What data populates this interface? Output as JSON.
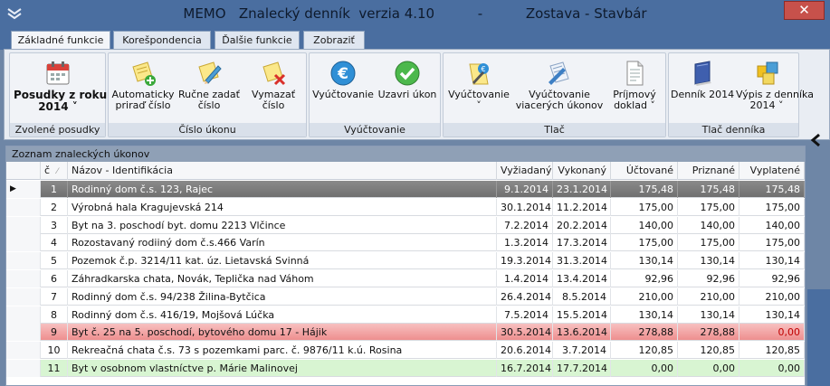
{
  "window": {
    "title": "MEMO   Znalecký denník  verzia 4.10          -          Zostava - Stavbár",
    "close_glyph": "✕"
  },
  "tabs": [
    {
      "label": "Základné funkcie",
      "active": true
    },
    {
      "label": "Korešpondencia",
      "active": false
    },
    {
      "label": "Ďalšie funkcie",
      "active": false
    },
    {
      "label": "Zobraziť",
      "active": false
    }
  ],
  "ribbon": {
    "groups": [
      {
        "label": "Zvolené posudky"
      },
      {
        "label": "Číslo úkonu"
      },
      {
        "label": "Vyúčtovanie"
      },
      {
        "label": "Tlač"
      },
      {
        "label": "Tlač denníka"
      }
    ],
    "buttons": {
      "posudky": {
        "line1": "Posudky z roku",
        "line2": "2014 ˅"
      },
      "auto": {
        "line1": "Automaticky",
        "line2": "priraď číslo"
      },
      "rucne": {
        "line1": "Ručne zadať",
        "line2": "číslo"
      },
      "vymazat": {
        "line1": "Vymazať",
        "line2": "číslo"
      },
      "vyuctovanie": {
        "line1": "Vyúčtovanie"
      },
      "uzavri": {
        "line1": "Uzavri úkon"
      },
      "tlac_vyuctovanie": {
        "line1": "Vyúčtovanie",
        "line2": "˅"
      },
      "tlac_viacerych": {
        "line1": "Vyúčtovanie",
        "line2": "viacerých úkonov"
      },
      "prijmovy": {
        "line1": "Príjmový",
        "line2": "doklad ˅"
      },
      "dennik": {
        "line1": "Denník 2014"
      },
      "vypis": {
        "line1": "Výpis z denníka",
        "line2": "2014 ˅"
      }
    }
  },
  "grid": {
    "caption": "Zoznam znaleckých úkonov",
    "columns": [
      "č",
      "Názov - Identifikácia",
      "Vyžiadaný",
      "Vykonaný",
      "Účtované",
      "Priznané",
      "Vyplatené"
    ],
    "sort_glyph": "⁄",
    "current_row_marker": "▶",
    "rows": [
      {
        "n": "1",
        "name": "Rodinný dom č.s. 123, Rajec",
        "req": "9.1.2014",
        "done": "23.1.2014",
        "billed": "175,48",
        "granted": "175,48",
        "paid": "175,48",
        "style": "selected"
      },
      {
        "n": "2",
        "name": "Výrobná hala Kragujevská 214",
        "req": "30.1.2014",
        "done": "11.2.2014",
        "billed": "175,00",
        "granted": "175,00",
        "paid": "175,00",
        "style": "normal"
      },
      {
        "n": "3",
        "name": "Byt na 3. poschodí byt. domu 2213 Vlčince",
        "req": "7.2.2014",
        "done": "20.2.2014",
        "billed": "140,00",
        "granted": "140,00",
        "paid": "140,00",
        "style": "normal"
      },
      {
        "n": "4",
        "name": "Rozostavaný rodiiný dom č.s.466 Varín",
        "req": "1.3.2014",
        "done": "17.3.2014",
        "billed": "175,00",
        "granted": "175,00",
        "paid": "175,00",
        "style": "normal"
      },
      {
        "n": "5",
        "name": "Pozemok č.p. 3214/11 kat. úz. Lietavská Svinná",
        "req": "19.3.2014",
        "done": "31.3.2014",
        "billed": "130,14",
        "granted": "130,14",
        "paid": "130,14",
        "style": "normal"
      },
      {
        "n": "6",
        "name": "Záhradkarska chata, Novák, Teplička nad Váhom",
        "req": "1.4.2014",
        "done": "13.4.2014",
        "billed": "92,96",
        "granted": "92,96",
        "paid": "92,96",
        "style": "normal"
      },
      {
        "n": "7",
        "name": "Rodinný dom č.s. 94/238 Žilina-Bytčica",
        "req": "26.4.2014",
        "done": "8.5.2014",
        "billed": "210,00",
        "granted": "210,00",
        "paid": "210,00",
        "style": "normal"
      },
      {
        "n": "8",
        "name": "Rodinný dom č.s. 416/19, Mojšová Lúčka",
        "req": "7.5.2014",
        "done": "15.5.2014",
        "billed": "130,14",
        "granted": "130,14",
        "paid": "130,14",
        "style": "normal"
      },
      {
        "n": "9",
        "name": "Byt č. 25 na 5. poschodí, bytového domu 17 - Hájik",
        "req": "30.5.2014",
        "done": "13.6.2014",
        "billed": "278,88",
        "granted": "278,88",
        "paid": "0,00",
        "style": "red"
      },
      {
        "n": "10",
        "name": "Rekreačná chata č.s. 73 s pozemkami parc. č. 9876/11 k.ú. Rosina",
        "req": "20.6.2014",
        "done": "3.7.2014",
        "billed": "120,85",
        "granted": "120,85",
        "paid": "120,85",
        "style": "normal"
      },
      {
        "n": "11",
        "name": "Byt v osobnom vlastníctve p. Márie Malinovej",
        "req": "16.7.2014",
        "done": "17.7.2014",
        "billed": "0,00",
        "granted": "0,00",
        "paid": "0,00",
        "style": "green"
      }
    ]
  },
  "colors": {
    "selected_row": "#7d7d7d",
    "red_row": "#f2a3a3",
    "green_row": "#d8f5d2",
    "title_bar": "#4a6ea0"
  }
}
